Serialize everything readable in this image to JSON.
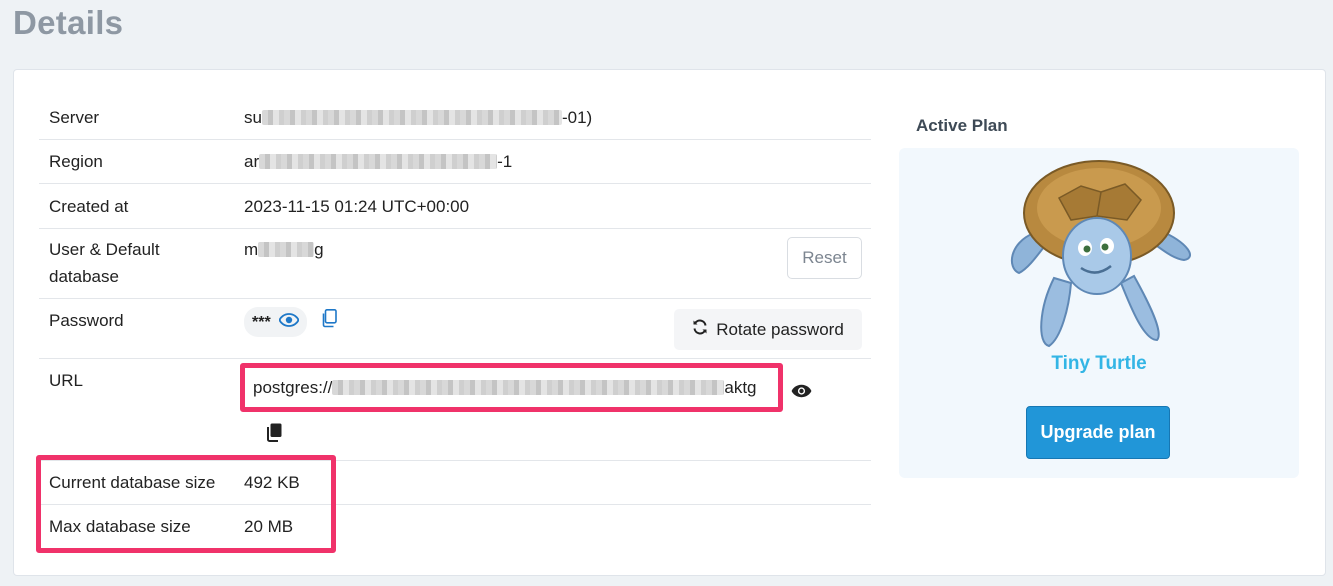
{
  "page": {
    "title": "Details"
  },
  "details": {
    "server": {
      "label": "Server",
      "prefix": "su",
      "suffix": "-01)"
    },
    "region": {
      "label": "Region",
      "prefix": "ar",
      "suffix": "-1"
    },
    "created": {
      "label": "Created at",
      "value": "2023-11-15 01:24 UTC+00:00"
    },
    "user": {
      "label": "User & Default database",
      "prefix": "m",
      "suffix": "g",
      "reset_label": "Reset"
    },
    "password": {
      "label": "Password",
      "masked": "***",
      "rotate_label": "Rotate password"
    },
    "url": {
      "label": "URL",
      "prefix": "postgres://",
      "suffix": "aktg"
    },
    "current_size": {
      "label": "Current database size",
      "value": "492 KB"
    },
    "max_size": {
      "label": "Max database size",
      "value": "20 MB"
    }
  },
  "plan": {
    "title": "Active Plan",
    "name": "Tiny Turtle",
    "upgrade_label": "Upgrade plan"
  },
  "colors": {
    "highlight": "#f0326a",
    "accent": "#2196d8",
    "plan_name": "#33b5e5",
    "icon_blue": "#1e78c8"
  },
  "icons": [
    "eye-icon",
    "copy-icon",
    "rotate-icon",
    "turtle-mascot"
  ]
}
